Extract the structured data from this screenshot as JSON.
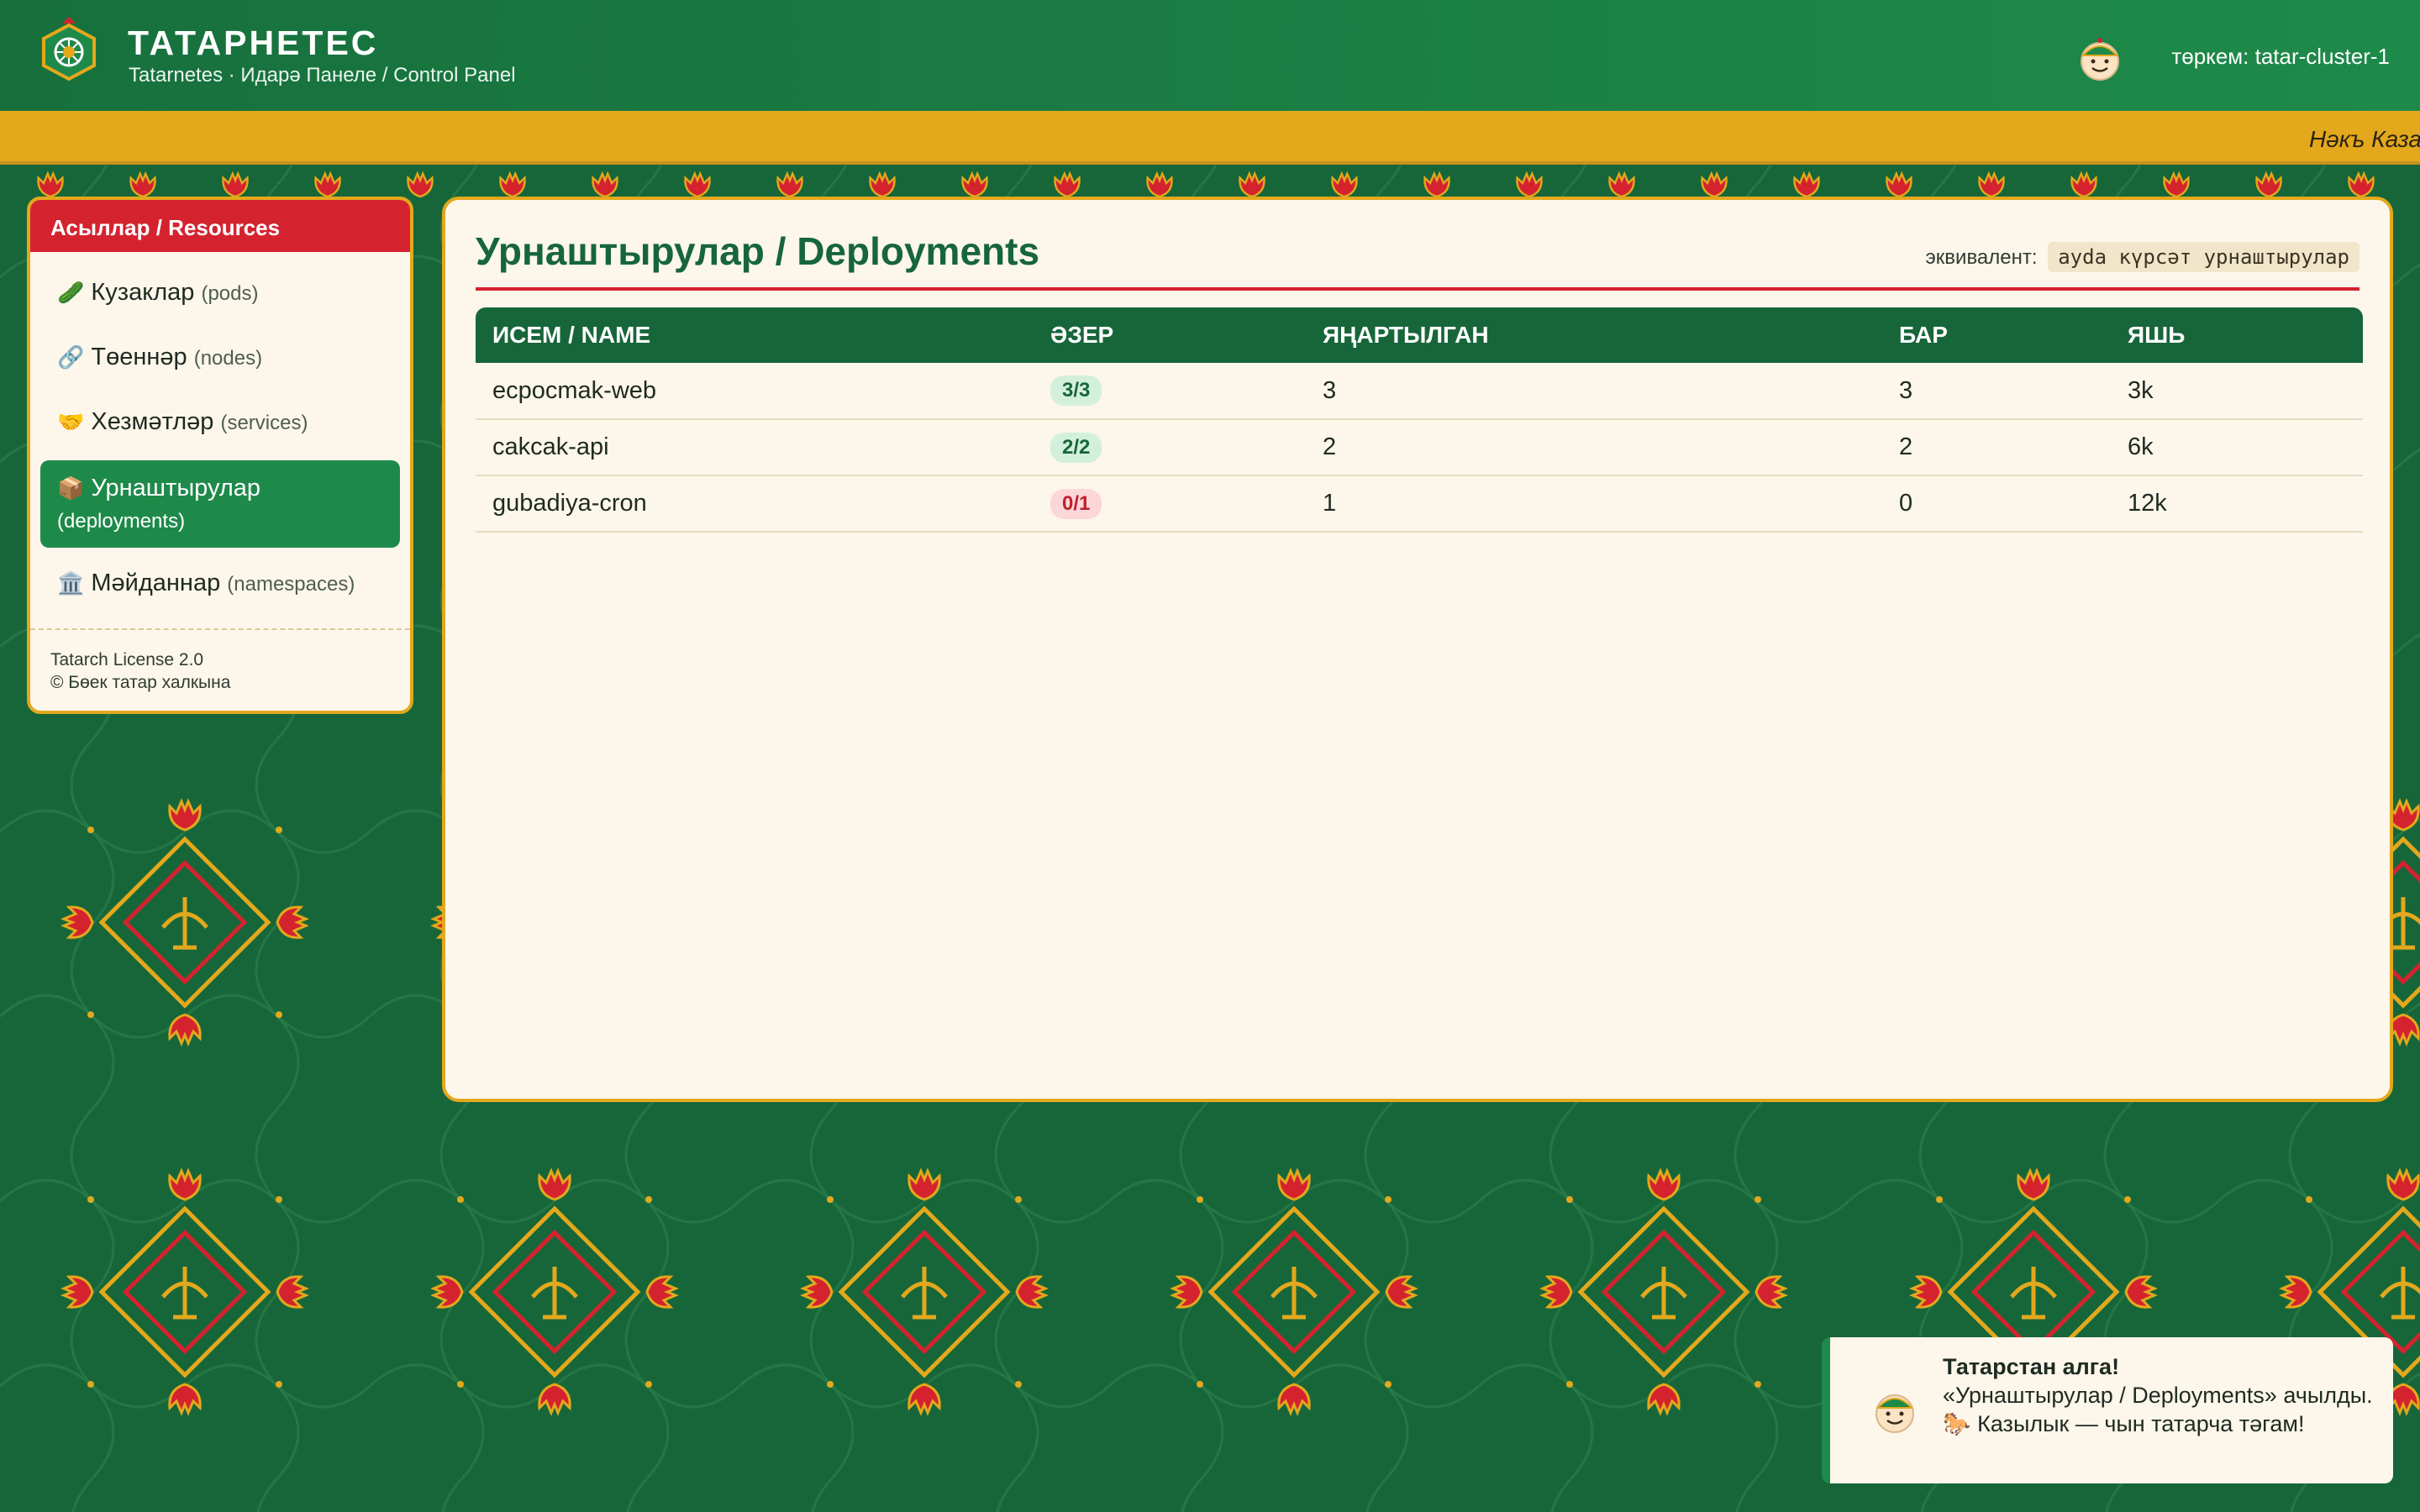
{
  "header": {
    "title": "ТАТАРНЕТЕС",
    "subtitle": "Tatarnetes · Идарә Панеле / Control Panel",
    "cluster_label": "төркем: tatar-cluster-1"
  },
  "ticker": {
    "text": "Нәкъ Каза"
  },
  "sidebar": {
    "heading": "Асыллар / Resources",
    "items": [
      {
        "icon": "🥒",
        "label": "Кузаклар",
        "en": "(pods)",
        "active": false
      },
      {
        "icon": "🔗",
        "label": "Төеннәр",
        "en": "(nodes)",
        "active": false
      },
      {
        "icon": "🤝",
        "label": "Хезмәтләр",
        "en": "(services)",
        "active": false
      },
      {
        "icon": "📦",
        "label": "Урнаштырулар",
        "en": "(deployments)",
        "active": true
      },
      {
        "icon": "🏛️",
        "label": "Мәйданнар",
        "en": "(namespaces)",
        "active": false
      }
    ],
    "footer_line1": "Tatarch License 2.0",
    "footer_line2": "© Бөек татар халкына"
  },
  "main": {
    "title": "Урнаштырулар / Deployments",
    "equivalent_label": "эквивалент:",
    "equivalent_command": "ayda күрсәт урнаштырулар",
    "table": {
      "columns": [
        "ИСЕМ / NAME",
        "ӘЗЕР",
        "ЯҢАРТЫЛГАН",
        "БАР",
        "ЯШЬ"
      ],
      "rows": [
        {
          "name": "ecpocmak-web",
          "ready": "3/3",
          "ready_ok": true,
          "updated": "3",
          "available": "3",
          "age": "3k"
        },
        {
          "name": "cakcak-api",
          "ready": "2/2",
          "ready_ok": true,
          "updated": "2",
          "available": "2",
          "age": "6k"
        },
        {
          "name": "gubadiya-cron",
          "ready": "0/1",
          "ready_ok": false,
          "updated": "1",
          "available": "0",
          "age": "12k"
        }
      ]
    }
  },
  "toast": {
    "title": "Татарстан алга!",
    "message": "«Урнаштырулар / Deployments» ачылды. 🐎 Казылык — чын татарча тәгам!"
  },
  "colors": {
    "green_dark": "#17663a",
    "green": "#1e8a4a",
    "gold": "#e3a81c",
    "red": "#d4232f",
    "cream": "#fdf6ea"
  }
}
